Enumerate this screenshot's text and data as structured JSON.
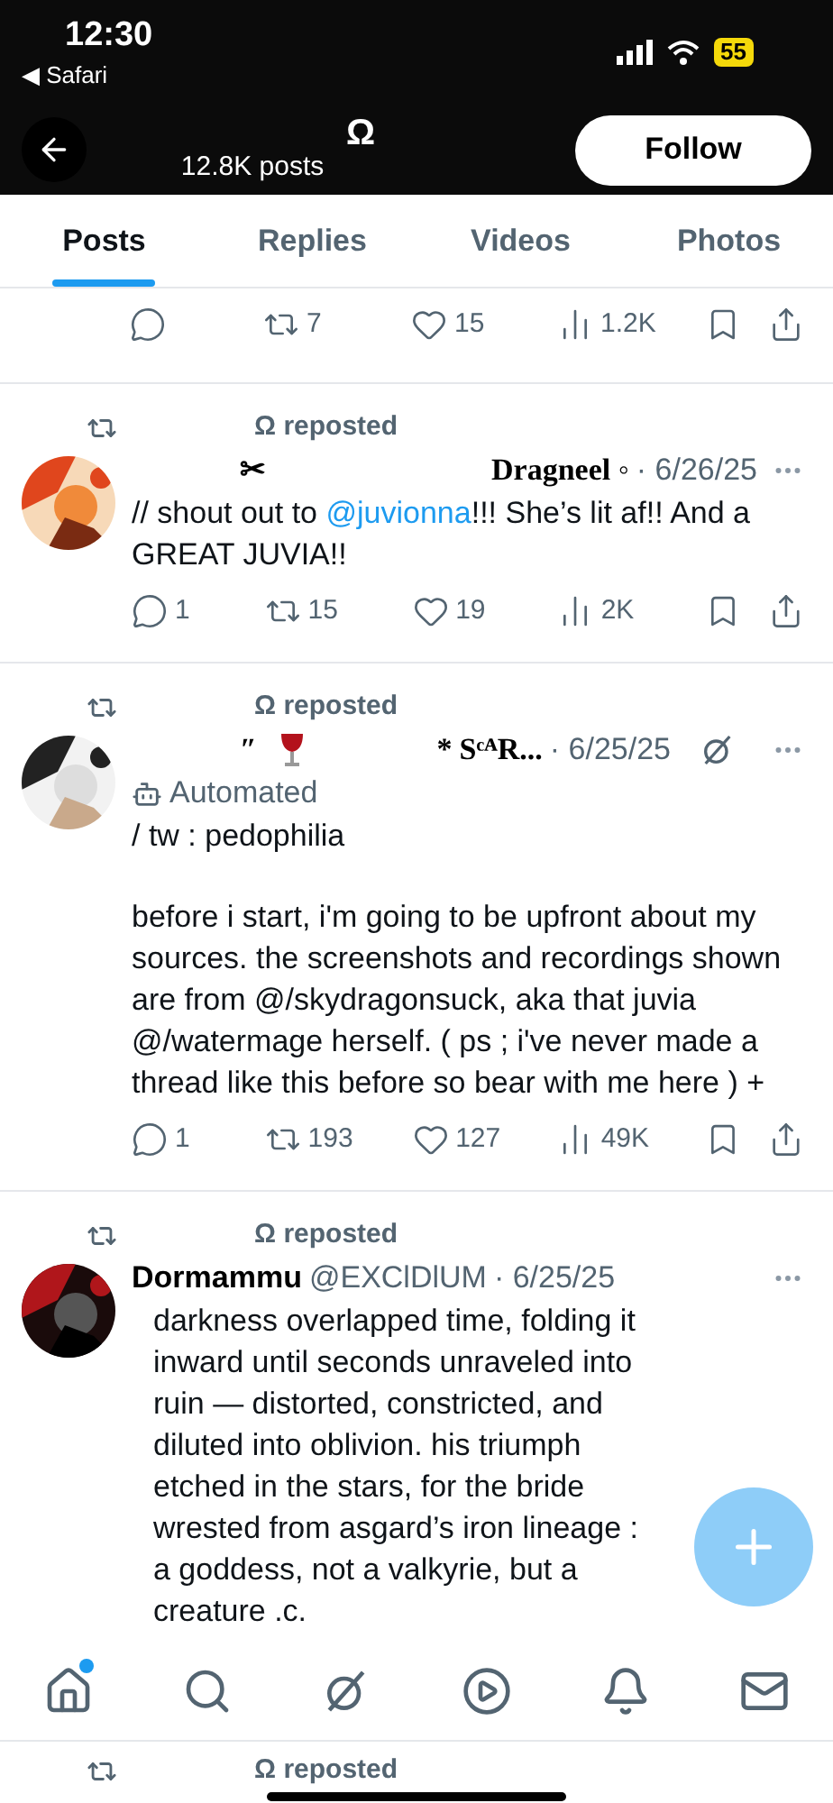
{
  "status_bar": {
    "time": "12:30",
    "back_app": "◀ Safari",
    "battery": "55"
  },
  "header": {
    "title": "Ω",
    "subtitle": "12.8K posts",
    "follow": "Follow"
  },
  "tabs": [
    {
      "label": "Posts",
      "selected": true
    },
    {
      "label": "Replies",
      "selected": false
    },
    {
      "label": "Videos",
      "selected": false
    },
    {
      "label": "Photos",
      "selected": false
    }
  ],
  "posts": [
    {
      "kind": "actions",
      "stats": {
        "reposts": "7",
        "likes": "15",
        "views": "1.2K"
      }
    },
    {
      "kind": "post",
      "repost_label": "Ω reposted",
      "name_parts": [
        "✂",
        "Dragneel ◦"
      ],
      "wine": false,
      "date": "· 6/26/25",
      "grok": false,
      "paragraphs": [
        "// shout out to **@juvionna**!!! She’s lit af!! And a GREAT JUVIA!!"
      ],
      "stats": {
        "replies": "1",
        "reposts": "15",
        "likes": "19",
        "views": "2K"
      }
    },
    {
      "kind": "post",
      "repost_label": "Ω reposted",
      "name_parts": [
        "″",
        "*",
        "SᶜᴬR..."
      ],
      "wine": true,
      "date": "· 6/25/25",
      "grok": true,
      "automated": "Automated",
      "paragraphs": [
        "/  tw  :  pedophilia",
        "before i start, i'm going to be upfront about my sources. the screenshots and recordings shown are from @/skydragonsuck, aka that juvia @/watermage herself. ( ps ; i've never made a thread like this before so bear with me here ) +"
      ],
      "stats": {
        "replies": "1",
        "reposts": "193",
        "likes": "127",
        "views": "49K"
      }
    },
    {
      "kind": "post",
      "repost_label": "Ω reposted",
      "name": "Dormammu",
      "handle": "@EXClDlUM",
      "date": "· 6/25/25",
      "grok": false,
      "indent": true,
      "paragraphs": [
        "darkness overlapped time, folding it inward until seconds unraveled into ruin — distorted, constricted, and diluted into oblivion. his triumph etched in the stars, for the bride wrested from asgard’s iron lineage : a goddess, not a valkyrie, but a creature .c."
      ]
    },
    {
      "kind": "repost_header",
      "repost_label": "Ω reposted"
    }
  ],
  "tab_bar": [
    {
      "kind": "home",
      "badge": true
    },
    {
      "kind": "search",
      "badge": false
    },
    {
      "kind": "grok",
      "badge": false
    },
    {
      "kind": "video",
      "badge": false
    },
    {
      "kind": "bell",
      "badge": false
    },
    {
      "kind": "mail",
      "badge": false
    }
  ]
}
